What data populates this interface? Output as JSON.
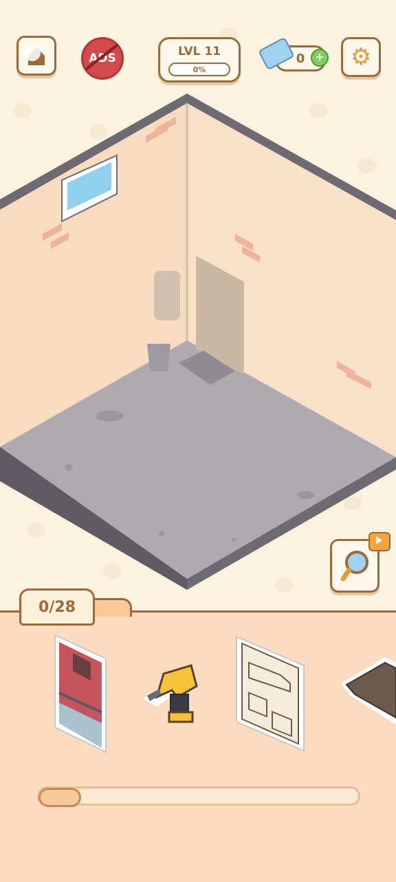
{
  "hud": {
    "ads_label": "ADS",
    "level_label": "LVL 11",
    "level_progress_text": "0%",
    "level_progress": 0,
    "tickets_count": "0",
    "plus_label": "+"
  },
  "inventory": {
    "count_label": "0/28",
    "scroll_position": 0.1,
    "items": [
      {
        "icon": "red-door"
      },
      {
        "icon": "cordless-drill"
      },
      {
        "icon": "car-blueprint-poster"
      },
      {
        "icon": "doormat"
      }
    ]
  },
  "colors": {
    "accent_brown": "#9b6a3a",
    "panel_bg": "#fcdcc0",
    "ads_red": "#d24a4a"
  }
}
